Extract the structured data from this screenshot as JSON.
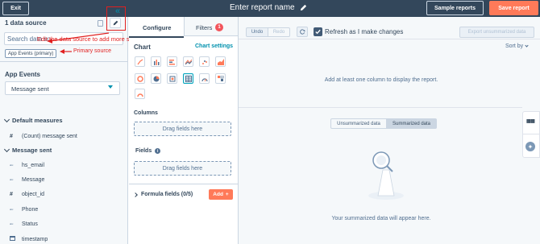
{
  "topbar": {
    "exit_label": "Exit",
    "report_name": "Enter report name",
    "sample_reports_label": "Sample reports",
    "save_report_label": "Save report"
  },
  "left": {
    "data_source_title": "1 data source",
    "search_placeholder": "Search data so",
    "primary_tag": "App Events (primary)",
    "annotation_edit": "Edit the data source to add more source/objects",
    "annotation_primary": "Primary source",
    "app_events_label": "App Events",
    "dropdown_value": "Message sent",
    "groups": [
      {
        "name": "Default measures",
        "fields": [
          {
            "type": "#",
            "name": "(Count) message sent"
          }
        ]
      },
      {
        "name": "Message sent",
        "fields": [
          {
            "type": "abc",
            "name": "hs_email"
          },
          {
            "type": "abc",
            "name": "Message"
          },
          {
            "type": "#",
            "name": "object_id"
          },
          {
            "type": "abc",
            "name": "Phone"
          },
          {
            "type": "abc",
            "name": "Status"
          },
          {
            "type": "cal",
            "name": "timestamp"
          }
        ]
      }
    ]
  },
  "config": {
    "tab_configure": "Configure",
    "tab_filters": "Filters",
    "filters_count": "1",
    "chart_label": "Chart",
    "chart_settings": "Chart settings",
    "columns_label": "Columns",
    "columns_drop": "Drag fields here",
    "fields_label": "Fields",
    "fields_drop": "Drag fields here",
    "formula_label": "Formula fields (0/5)",
    "add_label": "Add"
  },
  "report": {
    "undo_label": "Undo",
    "redo_label": "Redo",
    "refresh_label": "Refresh as I make changes",
    "refresh_checked": true,
    "export_label": "Export unsummarized data",
    "sort_label": "Sort by",
    "empty_message": "Add at least one column to display the report.",
    "seg_unsummarized": "Unsummarized data",
    "seg_summarized": "Summarized data",
    "summarized_message": "Your summarized data will appear here."
  },
  "colors": {
    "topbar": "#33475b",
    "save_button": "#ff7a59",
    "annotation": "#e02020",
    "link": "#0091ae"
  }
}
